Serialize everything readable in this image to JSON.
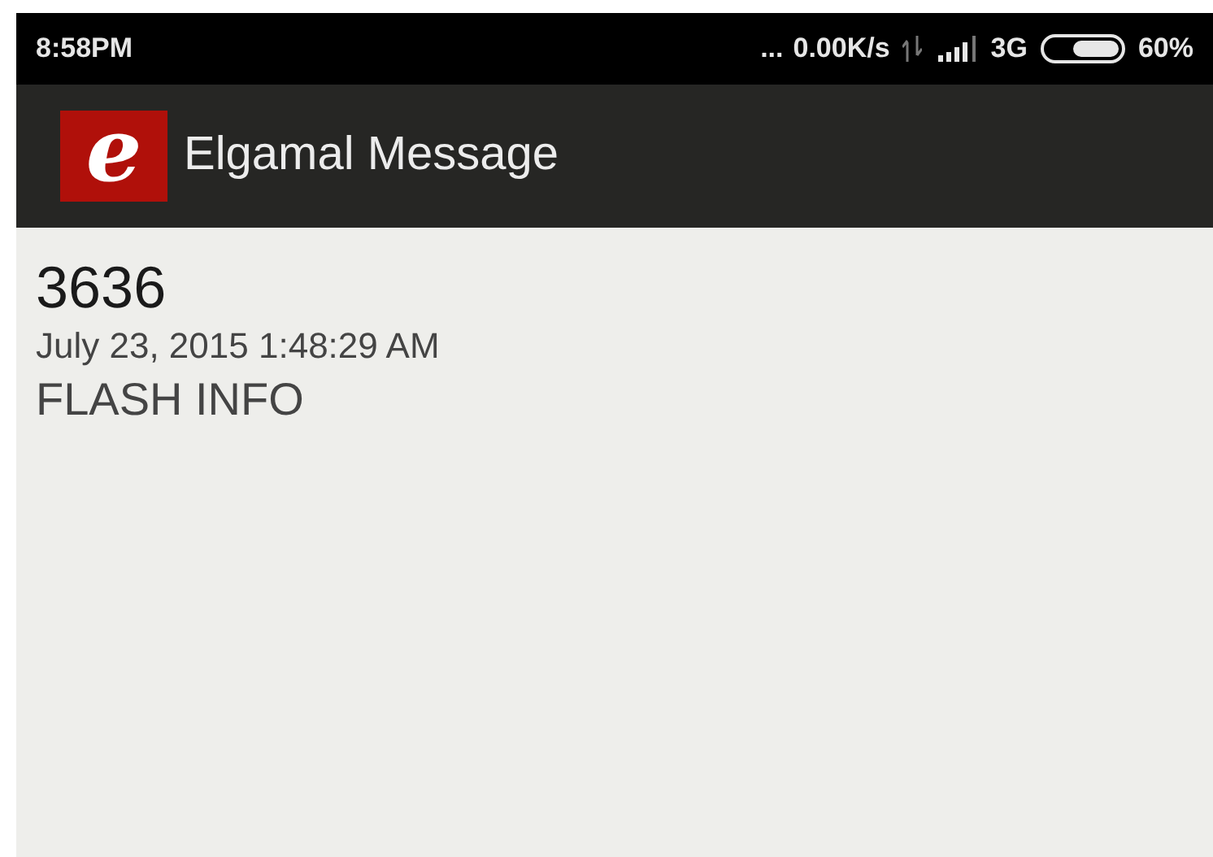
{
  "status_bar": {
    "time": "8:58PM",
    "dots": "...",
    "speed": "0.00K/s",
    "network": "3G",
    "battery": "60%"
  },
  "app_bar": {
    "logo_letter": "e",
    "title": "Elgamal Message"
  },
  "message": {
    "sender": "3636",
    "date": "July 23, 2015 1:48:29 AM",
    "body": "FLASH INFO"
  }
}
